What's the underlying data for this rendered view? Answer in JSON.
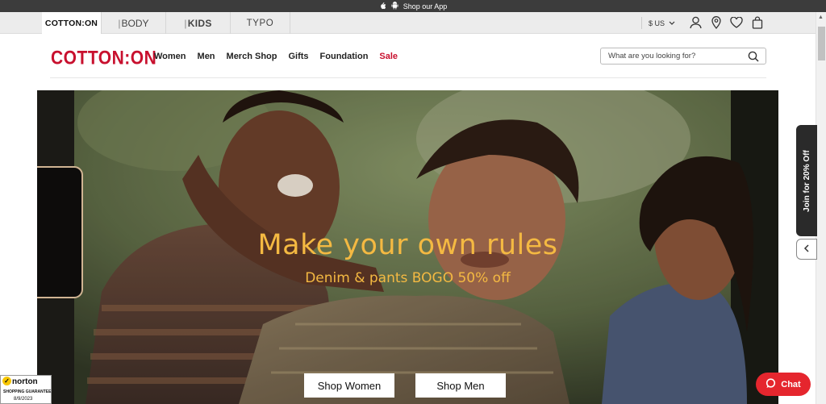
{
  "topbar": {
    "text": "Shop our App",
    "icons": [
      "apple-icon",
      "android-icon"
    ]
  },
  "brands": [
    {
      "label": "COTTON:ON",
      "active": true
    },
    {
      "label": "BODY",
      "active": false
    },
    {
      "label": "KIDS",
      "active": false
    },
    {
      "label": "TYPO",
      "active": false
    }
  ],
  "currency": "$ US",
  "header": {
    "logo": "COTTON:ON",
    "nav": [
      "Women",
      "Men",
      "Merch Shop",
      "Gifts",
      "Foundation",
      "Sale"
    ],
    "search_placeholder": "What are you looking for?"
  },
  "hero": {
    "title": "Make your own rules",
    "subtitle": "Denim & pants BOGO 50% off",
    "buttons": [
      "Shop Women",
      "Shop Men"
    ]
  },
  "side_tab": "Join for 20% Off",
  "norton": {
    "brand": "norton",
    "guarantee": "SHOPPING GUARANTEE",
    "date": "8/9/2023"
  },
  "chat": "Chat",
  "colors": {
    "brand_red": "#c8102e",
    "hero_text": "#f4b942",
    "chat": "#e5262e"
  }
}
